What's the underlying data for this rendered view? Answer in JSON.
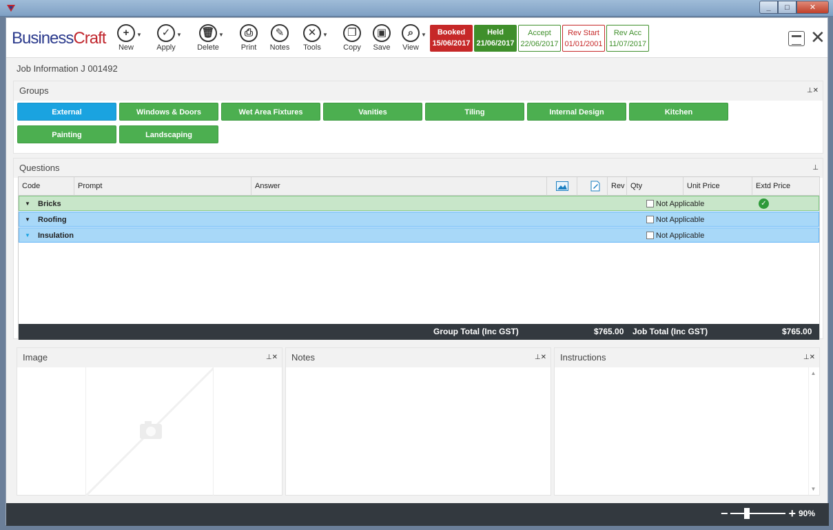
{
  "window": {
    "icon": "app-logo-icon",
    "min_label": "_",
    "max_label": "□",
    "close_label": "✕"
  },
  "toolbar": {
    "logo_part1": "Business",
    "logo_part2": "Craft",
    "tools": [
      {
        "label": "New",
        "icon": "plus-icon",
        "glyph": "+",
        "dropdown": true
      },
      {
        "label": "Apply",
        "icon": "check-icon",
        "glyph": "✓",
        "dropdown": true
      },
      {
        "label": "Delete",
        "icon": "trash-icon",
        "glyph": "🗑",
        "dropdown": true
      },
      {
        "label": "Print",
        "icon": "printer-icon",
        "glyph": "⎙",
        "dropdown": false
      },
      {
        "label": "Notes",
        "icon": "notes-icon",
        "glyph": "✎",
        "dropdown": false
      },
      {
        "label": "Tools",
        "icon": "tools-icon",
        "glyph": "✕",
        "dropdown": true
      },
      {
        "label": "Copy",
        "icon": "copy-icon",
        "glyph": "❐",
        "dropdown": false
      },
      {
        "label": "Save",
        "icon": "save-icon",
        "glyph": "▣",
        "dropdown": false
      },
      {
        "label": "View",
        "icon": "search-icon",
        "glyph": "⌕",
        "dropdown": true
      }
    ],
    "statuses": [
      {
        "label": "Booked",
        "date": "15/06/2017",
        "style": "filled-red"
      },
      {
        "label": "Held",
        "date": "21/06/2017",
        "style": "filled-green"
      },
      {
        "label": "Accept",
        "date": "22/06/2017",
        "style": "out-green"
      },
      {
        "label": "Rev Start",
        "date": "01/01/2001",
        "style": "out-red"
      },
      {
        "label": "Rev Acc",
        "date": "11/07/2017",
        "style": "out-green"
      }
    ],
    "close_glyph": "✕"
  },
  "job_info": "Job Information J 001492",
  "groups": {
    "title": "Groups",
    "pin": "⊥✕",
    "buttons": [
      "External",
      "Windows & Doors",
      "Wet Area Fixtures",
      "Vanities",
      "Tiling",
      "Internal Design",
      "Kitchen",
      "Painting",
      "Landscaping"
    ],
    "active": "External"
  },
  "questions": {
    "title": "Questions",
    "pin": "⊥",
    "columns": {
      "code": "Code",
      "prompt": "Prompt",
      "answer": "Answer",
      "rev": "Rev",
      "qty": "Qty",
      "unit_price": "Unit Price",
      "extd_price": "Extd Price"
    },
    "rows": [
      {
        "name": "Bricks",
        "na": "Not Applicable",
        "style": "green",
        "checked": true
      },
      {
        "name": "Roofing",
        "na": "Not Applicable",
        "style": "blue",
        "checked": false
      },
      {
        "name": "Insulation",
        "na": "Not Applicable",
        "style": "blue",
        "checked": false
      }
    ],
    "group_total_label": "Group Total (Inc GST)",
    "group_total": "$765.00",
    "job_total_label": "Job Total (Inc GST)",
    "job_total": "$765.00"
  },
  "image_panel": {
    "title": "Image",
    "pin": "⊥✕"
  },
  "notes_panel": {
    "title": "Notes",
    "pin": "⊥✕"
  },
  "instructions_panel": {
    "title": "Instructions",
    "pin": "⊥✕"
  },
  "zoom": {
    "minus": "−",
    "plus": "+",
    "value": "90%",
    "level": 0.9
  }
}
